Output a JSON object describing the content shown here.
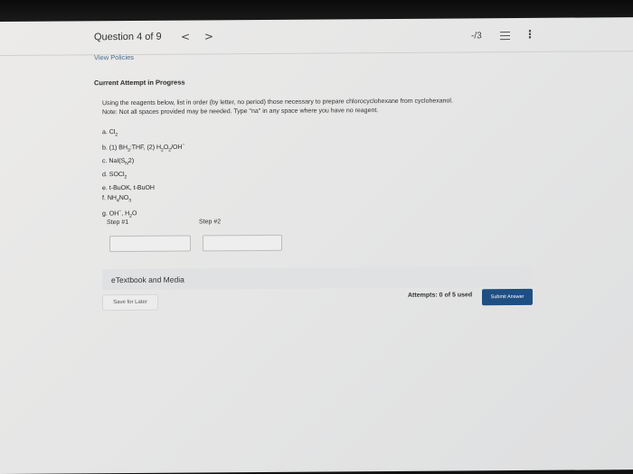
{
  "header": {
    "question_counter": "Question 4 of 9",
    "prev_glyph": "<",
    "next_glyph": ">",
    "score": "-/3",
    "more_glyph": "⋮"
  },
  "view_policies": "View Policies",
  "attempt_title": "Current Attempt in Progress",
  "instructions": {
    "line1": "Using the reagents below, list in order (by letter, no period) those necessary to prepare chlorocyclohexane from cyclohexanol.",
    "line2": "Note: Not all spaces provided may be needed. Type \"na\" in any space where you have no reagent."
  },
  "reagents": [
    {
      "letter": "a.",
      "parts": [
        [
          "Cl",
          ""
        ],
        [
          "2",
          "sub"
        ]
      ]
    },
    {
      "letter": "b.",
      "parts": [
        [
          "(1) BH",
          ""
        ],
        [
          "3",
          "sub"
        ],
        [
          ":THF, (2) H",
          ""
        ],
        [
          "2",
          "sub"
        ],
        [
          "O",
          ""
        ],
        [
          "2",
          "sub"
        ],
        [
          "/OH",
          ""
        ],
        [
          "−",
          "sup"
        ]
      ]
    },
    {
      "letter": "c.",
      "parts": [
        [
          "NaI(S",
          ""
        ],
        [
          "N",
          "sub"
        ],
        [
          "2)",
          ""
        ]
      ]
    },
    {
      "letter": "d.",
      "parts": [
        [
          "SOCl",
          ""
        ],
        [
          "2",
          "sub"
        ]
      ]
    },
    {
      "letter": "e.",
      "parts": [
        [
          "t-BuOK, t-BuOH",
          ""
        ]
      ]
    },
    {
      "letter": "f.",
      "parts": [
        [
          "NH",
          ""
        ],
        [
          "4",
          "sub"
        ],
        [
          "NO",
          ""
        ],
        [
          "3",
          "sub"
        ]
      ]
    },
    {
      "letter": "g.",
      "parts": [
        [
          "OH",
          ""
        ],
        [
          "−",
          "sup"
        ],
        [
          ", H",
          ""
        ],
        [
          "2",
          "sub"
        ],
        [
          "O",
          ""
        ]
      ]
    }
  ],
  "steps": {
    "step1_label": "Step #1",
    "step2_label": "Step #2",
    "step1_value": "",
    "step2_value": ""
  },
  "etextbook_label": "eTextbook and Media",
  "save_later_label": "Save for Later",
  "attempts_text": "Attempts: 0 of 5 used",
  "submit_label": "Submit Answer",
  "colors": {
    "submit_bg": "#1f4f82",
    "link": "#4a6a8a"
  },
  "icons": {
    "prev": "chevron-left-icon",
    "next": "chevron-right-icon",
    "list": "list-icon",
    "more": "more-vertical-icon"
  }
}
